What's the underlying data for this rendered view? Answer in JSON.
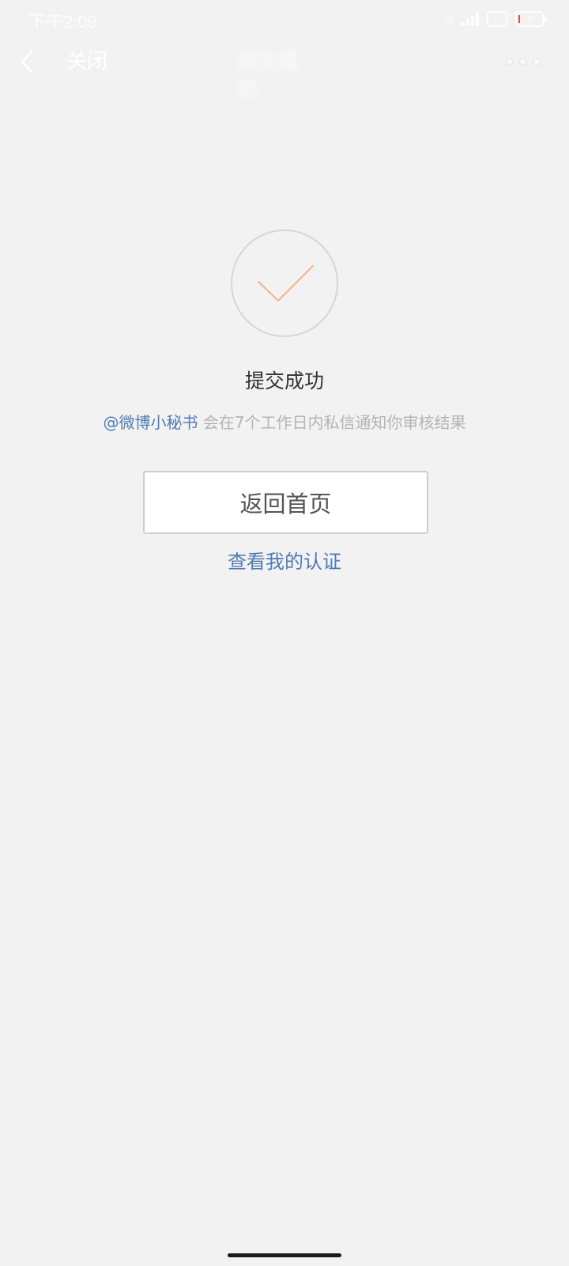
{
  "status_bar": {
    "time": "下午2:09",
    "network_label": "4G",
    "battery_level": "3"
  },
  "nav": {
    "close_label": "关闭",
    "title": "提交成功"
  },
  "content": {
    "title": "提交成功",
    "mention": "@微博小秘书",
    "notice": " 会在7个工作日内私信通知你审核结果",
    "home_button": "返回首页",
    "view_link": "查看我的认证"
  },
  "colors": {
    "background": "#f2f2f2",
    "link_blue": "#4e7bb5",
    "check_orange": "#f5b28c",
    "muted_text": "#b4b4b4"
  }
}
